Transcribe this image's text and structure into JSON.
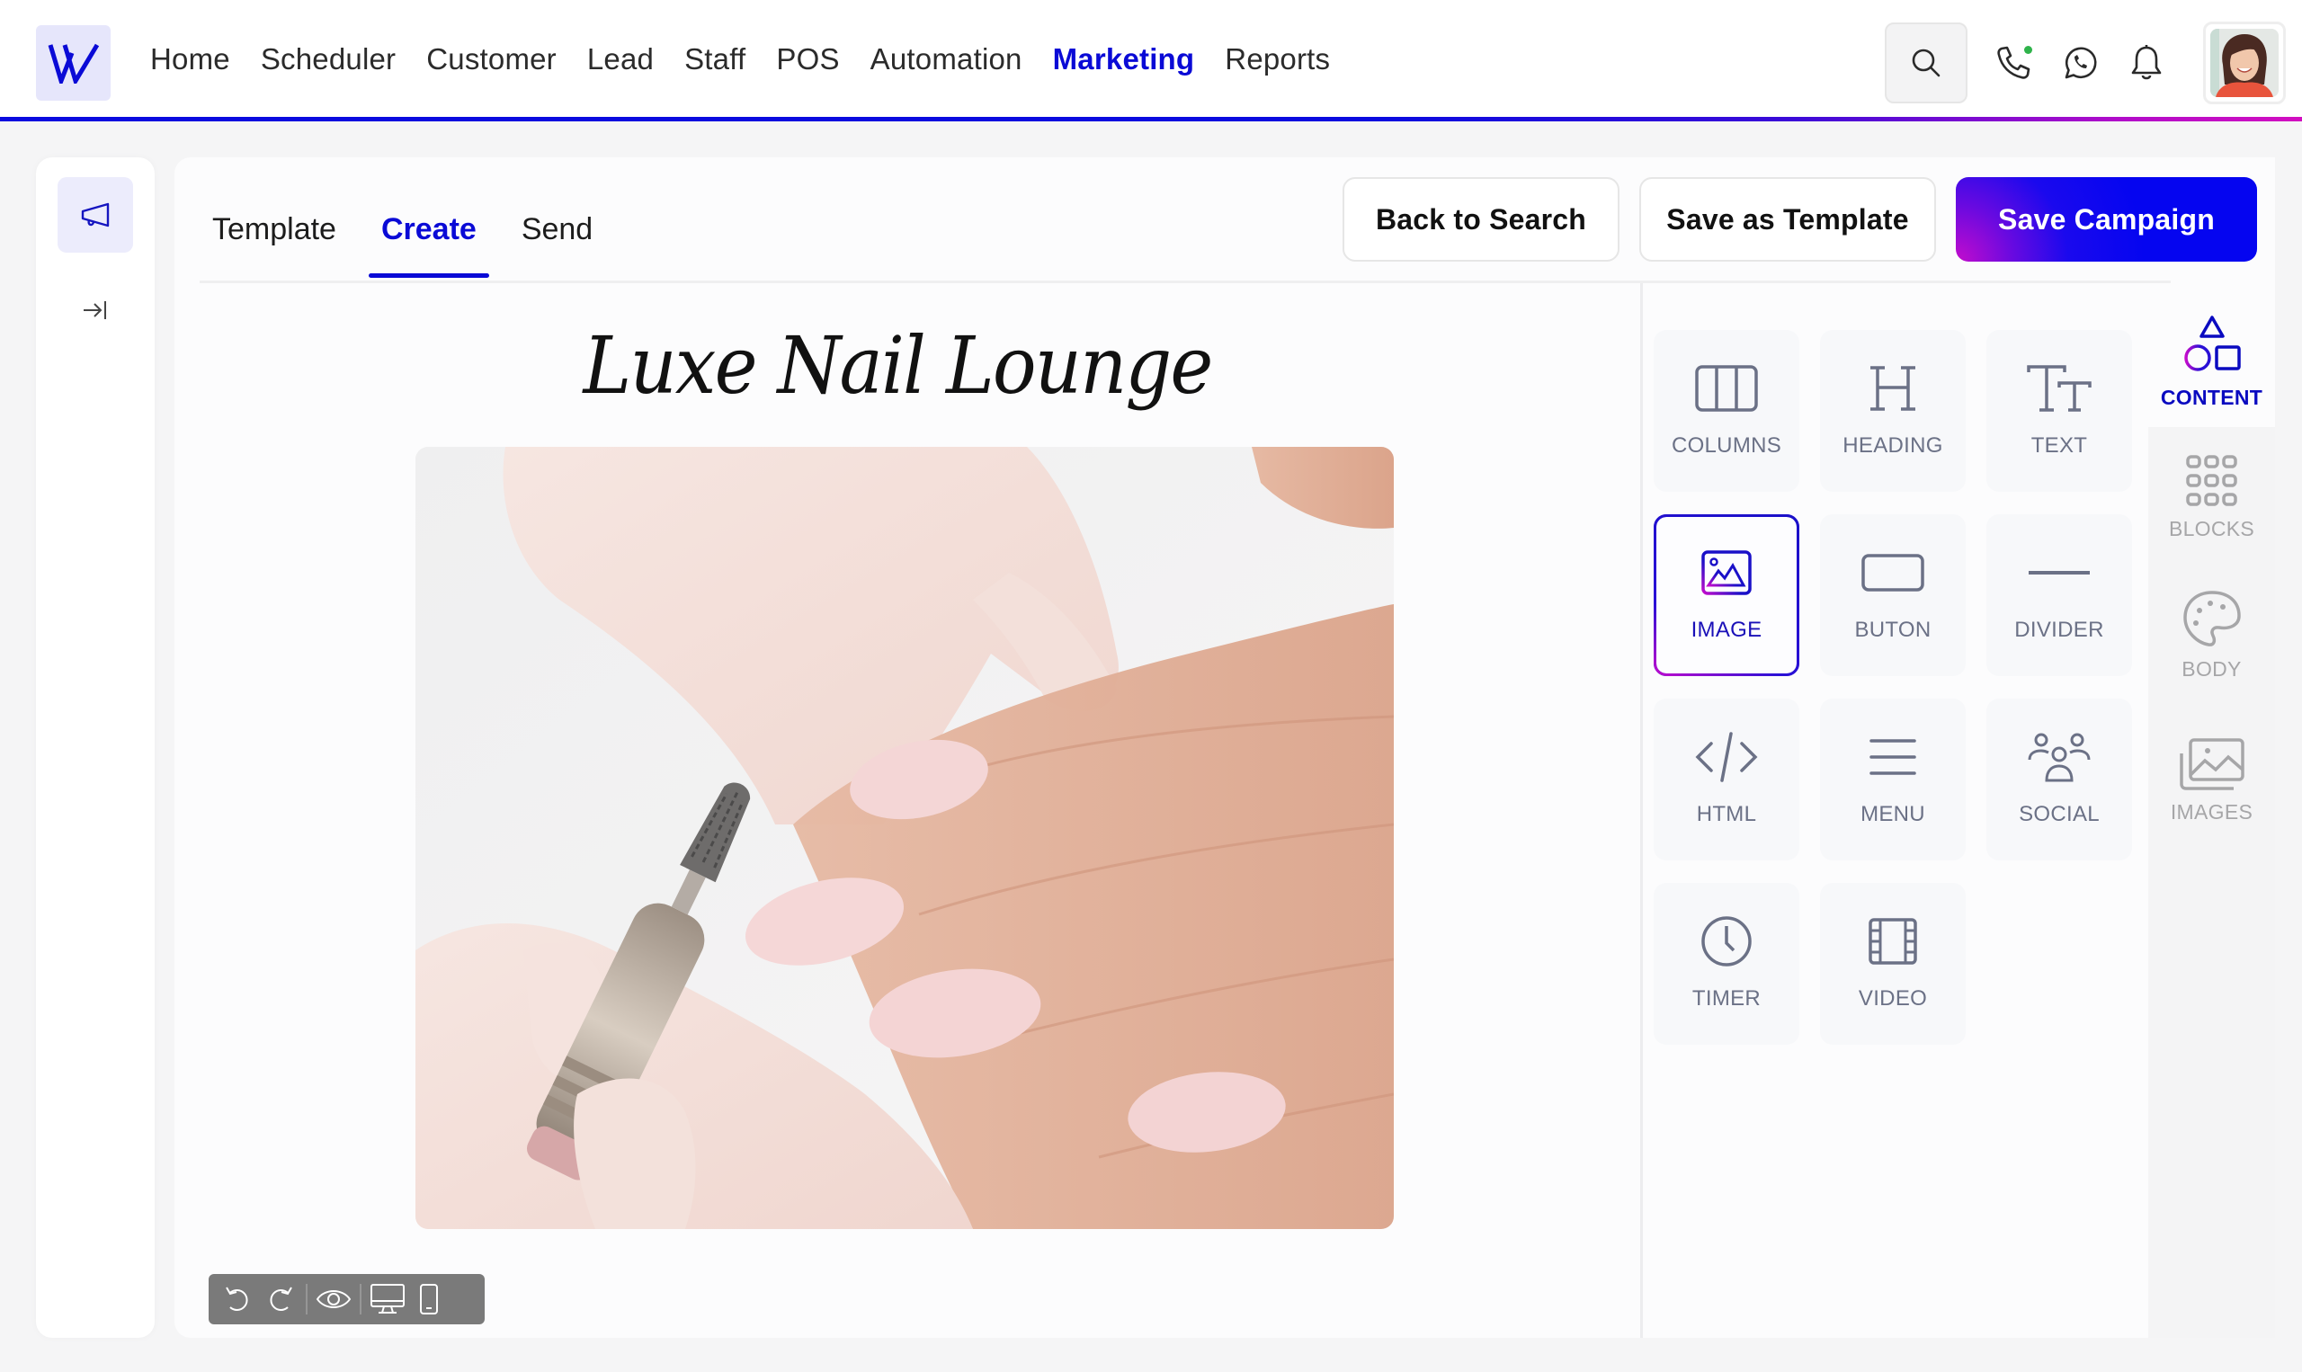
{
  "app": {
    "logo_letter": "W",
    "accent_color": "#0a0ad6",
    "gradient_end_color": "#c40ccc"
  },
  "header": {
    "nav": [
      {
        "label": "Home",
        "active": false
      },
      {
        "label": "Scheduler",
        "active": false
      },
      {
        "label": "Customer",
        "active": false
      },
      {
        "label": "Lead",
        "active": false
      },
      {
        "label": "Staff",
        "active": false
      },
      {
        "label": "POS",
        "active": false
      },
      {
        "label": "Automation",
        "active": false
      },
      {
        "label": "Marketing",
        "active": true
      },
      {
        "label": "Reports",
        "active": false
      }
    ],
    "actions": {
      "search_icon": "search-icon",
      "phone_icon": "phone-icon",
      "phone_status": "online",
      "whatsapp_icon": "whatsapp-icon",
      "notifications_icon": "bell-icon",
      "avatar": "user-avatar"
    }
  },
  "left_rail": {
    "items": [
      {
        "icon": "megaphone-icon",
        "active": true
      },
      {
        "icon": "expand-panel-icon",
        "active": false
      }
    ]
  },
  "editor": {
    "tabs": [
      {
        "label": "Template",
        "active": false
      },
      {
        "label": "Create",
        "active": true
      },
      {
        "label": "Send",
        "active": false
      }
    ],
    "buttons": {
      "back": "Back to Search",
      "save_template": "Save as Template",
      "save_campaign": "Save Campaign"
    },
    "canvas": {
      "title": "Luxe Nail Lounge",
      "image_alt": "Manicurist filing pink almond nails with an electric nail drill"
    },
    "toolbar": [
      {
        "icon": "undo-icon"
      },
      {
        "icon": "redo-icon"
      },
      {
        "icon": "preview-eye-icon"
      },
      {
        "icon": "desktop-view-icon"
      },
      {
        "icon": "mobile-view-icon"
      }
    ]
  },
  "content_panel": {
    "tools": [
      {
        "label": "COLUMNS",
        "icon": "columns-icon",
        "active": false
      },
      {
        "label": "HEADING",
        "icon": "heading-icon",
        "active": false
      },
      {
        "label": "TEXT",
        "icon": "text-icon",
        "active": false
      },
      {
        "label": "IMAGE",
        "icon": "image-icon",
        "active": true
      },
      {
        "label": "BUTON",
        "icon": "button-icon",
        "active": false
      },
      {
        "label": "DIVIDER",
        "icon": "divider-icon",
        "active": false
      },
      {
        "label": "HTML",
        "icon": "code-icon",
        "active": false
      },
      {
        "label": "MENU",
        "icon": "menu-icon",
        "active": false
      },
      {
        "label": "SOCIAL",
        "icon": "social-icon",
        "active": false
      },
      {
        "label": "TIMER",
        "icon": "timer-icon",
        "active": false
      },
      {
        "label": "VIDEO",
        "icon": "video-icon",
        "active": false
      }
    ]
  },
  "right_rail": {
    "tabs": [
      {
        "label": "CONTENT",
        "icon": "shapes-icon",
        "active": true
      },
      {
        "label": "BLOCKS",
        "icon": "blocks-grid-icon",
        "active": false
      },
      {
        "label": "BODY",
        "icon": "palette-icon",
        "active": false
      },
      {
        "label": "IMAGES",
        "icon": "images-icon",
        "active": false
      }
    ]
  }
}
